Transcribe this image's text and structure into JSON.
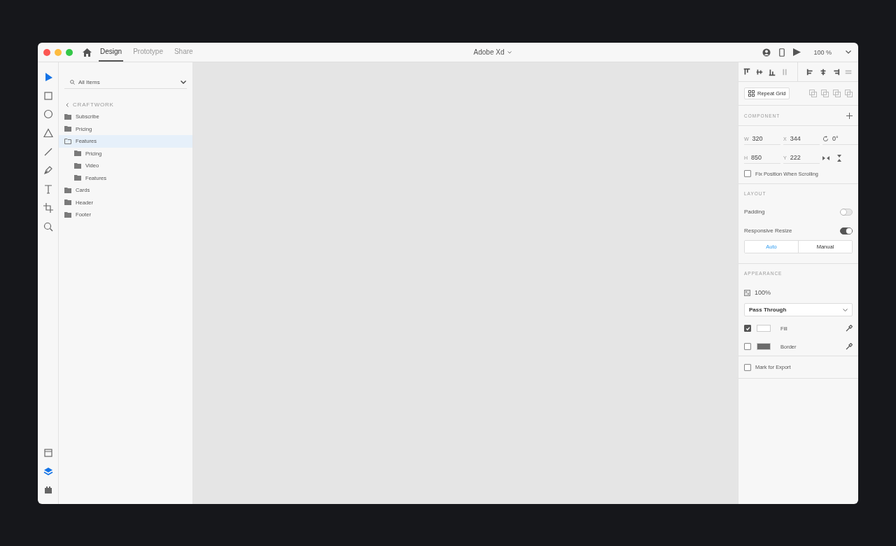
{
  "window": {
    "title": "Adobe Xd",
    "tabs": [
      {
        "label": "Design",
        "selected": true
      },
      {
        "label": "Prototype",
        "selected": false
      },
      {
        "label": "Share",
        "selected": false
      }
    ],
    "zoom": "100 %"
  },
  "tools": [
    {
      "kind": "select",
      "selected": true
    },
    {
      "kind": "rectangle",
      "selected": false
    },
    {
      "kind": "ellipse",
      "selected": false
    },
    {
      "kind": "polygon",
      "selected": false
    },
    {
      "kind": "line",
      "selected": false
    },
    {
      "kind": "pen",
      "selected": false
    },
    {
      "kind": "text",
      "selected": false
    },
    {
      "kind": "artboard",
      "selected": false
    },
    {
      "kind": "zoom",
      "selected": false
    }
  ],
  "bottom_tools": [
    {
      "kind": "assets",
      "selected": false
    },
    {
      "kind": "layers",
      "selected": true
    },
    {
      "kind": "plugins",
      "selected": false
    }
  ],
  "layers": {
    "filter": "All Items",
    "breadcrumb": "CRAFTWORK",
    "items": [
      {
        "label": "Subscribe",
        "selected": false,
        "expanded": false
      },
      {
        "label": "Pricing",
        "selected": false,
        "expanded": false
      },
      {
        "label": "Features",
        "selected": true,
        "expanded": true,
        "children": [
          {
            "label": "Pricing",
            "selected": false,
            "expanded": false
          },
          {
            "label": "Video",
            "selected": false,
            "expanded": false
          },
          {
            "label": "Features",
            "selected": false,
            "expanded": false
          }
        ]
      },
      {
        "label": "Cards",
        "selected": false,
        "expanded": false
      },
      {
        "label": "Header",
        "selected": false,
        "expanded": false
      },
      {
        "label": "Footer",
        "selected": false,
        "expanded": false
      }
    ]
  },
  "inspector": {
    "repeat_grid": "Repeat Grid",
    "component_title": "COMPONENT",
    "fields": [
      {
        "kind": "labeled",
        "label": "W",
        "value": "320"
      },
      {
        "kind": "labeled",
        "label": "X",
        "value": "344"
      },
      {
        "kind": "rotation",
        "value": "0°"
      },
      {
        "kind": "labeled",
        "label": "H",
        "value": "850"
      },
      {
        "kind": "labeled",
        "label": "Y",
        "value": "222"
      }
    ],
    "fix_position": {
      "label": "Fix Position When Scrolling",
      "checked": false
    },
    "layout_title": "LAYOUT",
    "toggles": [
      {
        "label": "Padding",
        "on": false
      },
      {
        "label": "Responsive Resize",
        "on": true
      }
    ],
    "resize_modes": [
      {
        "label": "Auto",
        "selected": true
      },
      {
        "label": "Manual",
        "selected": false
      }
    ],
    "appearance_title": "APPEARANCE",
    "opacity": "100%",
    "blend": "Pass Through",
    "paints": [
      {
        "label": "Fill",
        "checked": true,
        "color": "#ffffff"
      },
      {
        "label": "Border",
        "checked": false,
        "color": "#6b6b6b"
      }
    ],
    "export": {
      "label": "Mark for Export",
      "checked": false
    }
  }
}
